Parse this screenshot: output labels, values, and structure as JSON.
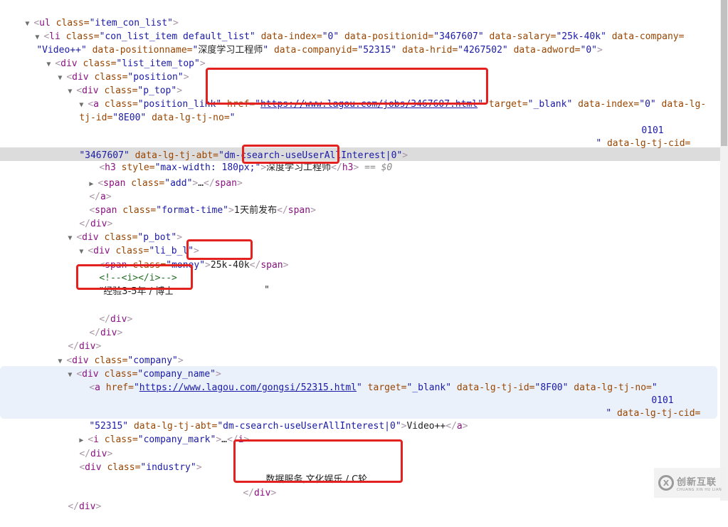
{
  "dom": {
    "ul_tag": "ul",
    "ul_attr_class": "class",
    "ul_class": "item_con_list",
    "li": {
      "tag": "li",
      "class": "con_list_item default_list",
      "data_index": "0",
      "data_positionid": "3467607",
      "data_salary": "25k-40k",
      "data_company": "Video++",
      "data_positionname": "深度学习工程师",
      "data_companyid": "52315",
      "data_hrid": "4267502",
      "data_adword": "0"
    },
    "list_item_top_class": "list_item_top",
    "position_class": "position",
    "p_top_class": "p_top",
    "position_link": {
      "class": "position_link",
      "href": "https://www.lagou.com/jobs/3467607.html",
      "target": "_blank",
      "data_index": "0",
      "tj_id": "8E00",
      "tj_no_value": "0101",
      "tj_cid": "3467607",
      "tj_abt": "dm-csearch-useUserAllInterest|0"
    },
    "h3": {
      "style": "max-width: 180px;",
      "text": "深度学习工程师",
      "selected_marker": "== $0"
    },
    "add_span_class": "add",
    "ellipsis": "…",
    "format_time": {
      "class": "format-time",
      "text": "1天前发布"
    },
    "p_bot_class": "p_bot",
    "li_b_l_class": "li_b_l",
    "money": {
      "class": "money",
      "text": "25k-40k"
    },
    "comment": "<!--<i></i>-->",
    "experience_text": "经验3-5年 / 博士",
    "company_class": "company",
    "company_name_class": "company_name",
    "company_link": {
      "href": "https://www.lagou.com/gongsi/52315.html",
      "target": "_blank",
      "tj_id": "8F00",
      "tj_no_value": "0101",
      "tj_cid": "52315",
      "tj_abt": "dm-csearch-useUserAllInterest|0",
      "text": "Video++"
    },
    "company_mark_class": "company_mark",
    "industry": {
      "class": "industry",
      "text": "数据服务,文化娱乐 / C轮"
    }
  },
  "colors": {
    "annotation_red": "#e3211f",
    "selected_row": "#dcdcdc",
    "hover_row": "#eaf1fb",
    "tag": "#881280",
    "attr_name": "#994500",
    "attr_value": "#1a1aa6"
  },
  "watermark": {
    "cn": "创新互联",
    "en": "CHUANG XIN HU LIAN",
    "logo": "X"
  }
}
